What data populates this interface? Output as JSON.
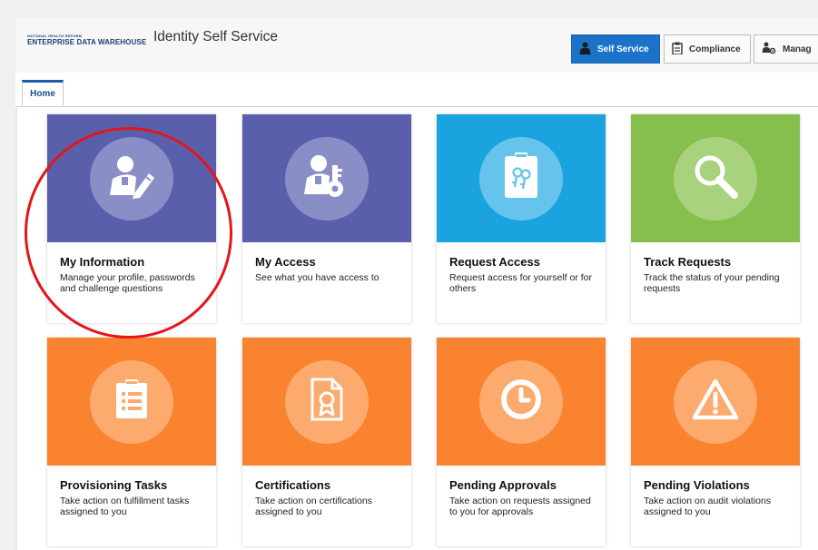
{
  "header": {
    "logo_small": "NATIONAL HEALTH REFORM",
    "logo_big": "ENTERPRISE DATA WAREHOUSE",
    "app_title": "Identity Self Service",
    "buttons": [
      {
        "label": "Self Service",
        "icon": "person-icon",
        "active": true
      },
      {
        "label": "Compliance",
        "icon": "clipboard-icon",
        "active": false
      },
      {
        "label": "Manag",
        "icon": "people-gear-icon",
        "active": false
      }
    ]
  },
  "tabs": [
    {
      "label": "Home",
      "selected": true
    }
  ],
  "tiles": [
    {
      "title": "My Information",
      "desc": "Manage your profile, passwords and challenge questions",
      "icon": "user-edit-icon"
    },
    {
      "title": "My Access",
      "desc": "See what you have access to",
      "icon": "user-key-icon"
    },
    {
      "title": "Request Access",
      "desc": "Request access for yourself or for others",
      "icon": "badge-keys-icon"
    },
    {
      "title": "Track Requests",
      "desc": "Track the status of your pending requests",
      "icon": "magnifier-icon"
    },
    {
      "title": "Provisioning Tasks",
      "desc": "Take action on fulfillment tasks assigned to you",
      "icon": "task-list-icon"
    },
    {
      "title": "Certifications",
      "desc": "Take action on certifications assigned to you",
      "icon": "certificate-icon"
    },
    {
      "title": "Pending Approvals",
      "desc": "Take action on requests assigned to you for approvals",
      "icon": "clock-icon"
    },
    {
      "title": "Pending Violations",
      "desc": "Take action on audit violations assigned to you",
      "icon": "warning-icon"
    }
  ],
  "colors": {
    "purple": "#5a5fab",
    "purple_circle": "#8a8ec7",
    "blue": "#1aa3de",
    "blue_circle": "#66c4ec",
    "green": "#86bf4d",
    "green_circle": "#a8d27d",
    "orange": "#fa8330",
    "orange_circle": "#fcaa6d",
    "highlight_red": "#e3161a",
    "nav_active": "#1a73c8"
  }
}
